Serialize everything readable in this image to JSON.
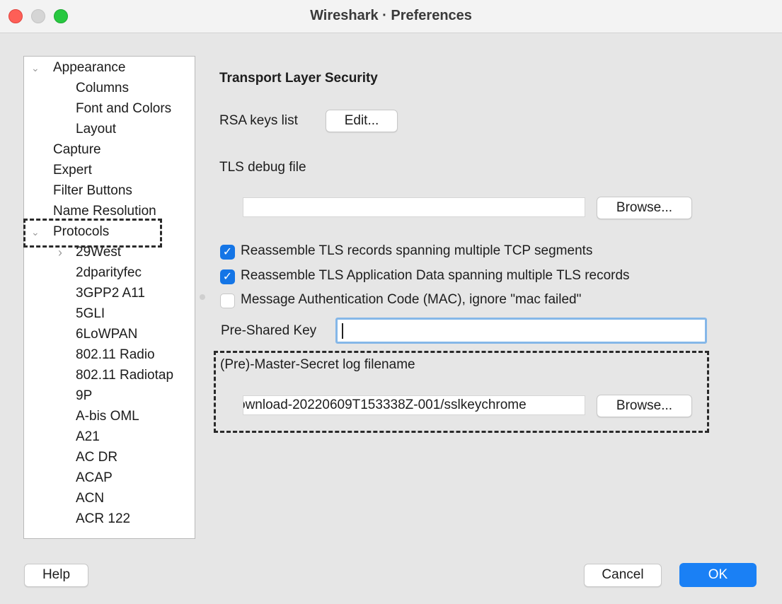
{
  "window": {
    "title": "Wireshark · Preferences"
  },
  "tree": {
    "items": [
      {
        "label": "Appearance",
        "chevron": "⌄"
      },
      {
        "label": "Columns"
      },
      {
        "label": "Font and Colors"
      },
      {
        "label": "Layout"
      },
      {
        "label": "Capture"
      },
      {
        "label": "Expert"
      },
      {
        "label": "Filter Buttons"
      },
      {
        "label": "Name Resolution"
      },
      {
        "label": "Protocols",
        "chevron": "⌄"
      },
      {
        "label": "29West",
        "chevron": "›"
      },
      {
        "label": "2dparityfec"
      },
      {
        "label": "3GPP2 A11"
      },
      {
        "label": "5GLI"
      },
      {
        "label": "6LoWPAN"
      },
      {
        "label": "802.11 Radio"
      },
      {
        "label": "802.11 Radiotap"
      },
      {
        "label": "9P"
      },
      {
        "label": "A-bis OML"
      },
      {
        "label": "A21"
      },
      {
        "label": "AC DR"
      },
      {
        "label": "ACAP"
      },
      {
        "label": "ACN"
      },
      {
        "label": "ACR 122"
      }
    ]
  },
  "panel": {
    "heading": "Transport Layer Security",
    "rsa_label": "RSA keys list",
    "edit_button": "Edit...",
    "debug_label": "TLS debug file",
    "debug_value": "",
    "browse_button": "Browse...",
    "checkboxes": [
      {
        "label": "Reassemble TLS records spanning multiple TCP segments",
        "checked": true
      },
      {
        "label": "Reassemble TLS Application Data spanning multiple TLS records",
        "checked": true
      },
      {
        "label": "Message Authentication Code (MAC), ignore \"mac failed\"",
        "checked": false
      }
    ],
    "psk_label": "Pre-Shared Key",
    "psk_value": "",
    "master_label": "(Pre)-Master-Secret log filename",
    "master_value": "ownload-20220609T153338Z-001/sslkeychrome",
    "browse_button_2": "Browse..."
  },
  "footer": {
    "help": "Help",
    "cancel": "Cancel",
    "ok": "OK"
  },
  "colors": {
    "accent": "#1a80f5",
    "checkbox": "#1475e6",
    "focus_ring": "#85b7e8",
    "close": "#fe5f57",
    "maximize": "#28c840"
  }
}
